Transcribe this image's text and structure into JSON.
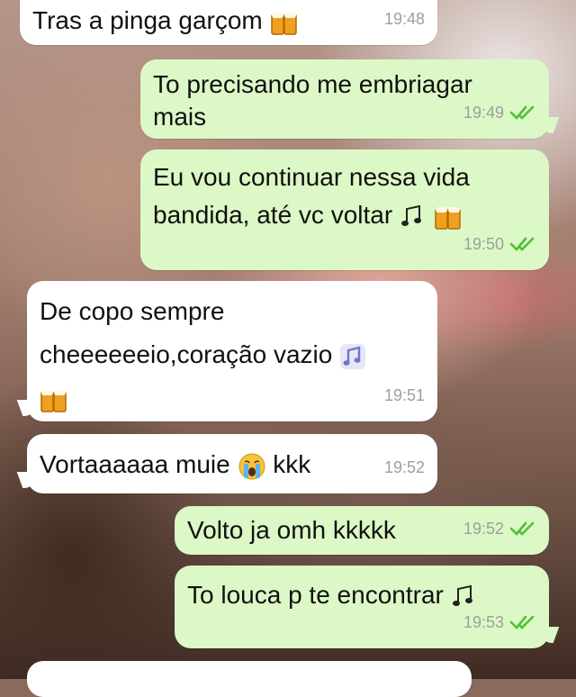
{
  "messages": [
    {
      "id": "m1",
      "direction": "incoming",
      "text": "Tras a pinga garçom",
      "emoji": "beer",
      "time": "19:48"
    },
    {
      "id": "m2",
      "direction": "outgoing",
      "text": "To precisando me embriagar mais",
      "time": "19:49",
      "status": "read"
    },
    {
      "id": "m3",
      "direction": "outgoing",
      "text": "Eu vou continuar nessa vida bandida, até vc voltar",
      "emoji": "notes beer",
      "time": "19:50",
      "status": "read"
    },
    {
      "id": "m4",
      "direction": "incoming",
      "text": "De copo sempre cheeeeeeio,coração vazio",
      "emoji": "music-note beer",
      "time": "19:51"
    },
    {
      "id": "m5",
      "direction": "incoming",
      "text": "Vortaaaaaa muie",
      "text_after": "kkk",
      "emoji": "crying-face",
      "time": "19:52"
    },
    {
      "id": "m6",
      "direction": "outgoing",
      "text": "Volto ja omh kkkkk",
      "time": "19:52",
      "status": "read"
    },
    {
      "id": "m7",
      "direction": "outgoing",
      "text": "To louca p te encontrar",
      "emoji": "notes",
      "time": "19:53",
      "status": "read"
    }
  ],
  "colors": {
    "incoming_bubble": "#ffffff",
    "outgoing_bubble": "#dcf8c6",
    "read_tick": "#4fc134",
    "timestamp": "#9aa19a"
  }
}
